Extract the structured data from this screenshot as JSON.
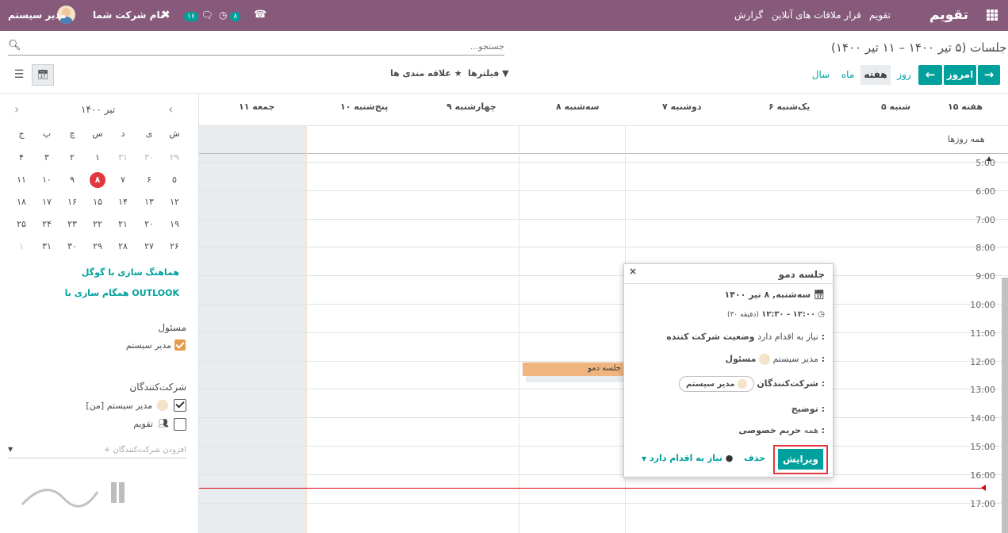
{
  "topbar": {
    "app_title": "تقویم",
    "menu": [
      "تقویم",
      "قرار ملاقات های آنلاین",
      "گزارش"
    ],
    "company": "نام شرکت شما",
    "user": "مدیر سیستم",
    "activity_count": "۸",
    "messages_count": "۱۶"
  },
  "breadcrumb": "جلسات (۵ تیر ۱۴۰۰ – ۱۱ تیر ۱۴۰۰)",
  "search": {
    "placeholder": "جستجو..."
  },
  "controls": {
    "today": "امروز",
    "day": "روز",
    "week": "هفته",
    "month": "ماه",
    "year": "سال",
    "filters": "فیلترها",
    "favorites": "علاقه مندی ها"
  },
  "week_header": {
    "week_label": "هفته ۱۵",
    "days": [
      "شنبه ۵",
      "یک‌شنبه ۶",
      "دوشنبه ۷",
      "سه‌شنبه ۸",
      "چهارشنبه ۹",
      "پنج‌شنبه ۱۰",
      "جمعه ۱۱"
    ],
    "all_day": "همه روزها"
  },
  "hours": [
    "5:00",
    "6:00",
    "7:00",
    "8:00",
    "9:00",
    "10:00",
    "11:00",
    "12:00",
    "13:00",
    "14:00",
    "15:00",
    "16:00",
    "17:00"
  ],
  "event": {
    "title": "جلسه دمو"
  },
  "mini_calendar": {
    "month": "تیر ۱۴۰۰",
    "weekdays": [
      "ش",
      "ی",
      "د",
      "س",
      "چ",
      "پ",
      "ج"
    ],
    "weeks": [
      [
        "۲۹",
        "۳۰",
        "۳۱",
        "۱",
        "۲",
        "۳",
        "۴"
      ],
      [
        "۵",
        "۶",
        "۷",
        "۸",
        "۹",
        "۱۰",
        "۱۱"
      ],
      [
        "۱۲",
        "۱۳",
        "۱۴",
        "۱۵",
        "۱۶",
        "۱۷",
        "۱۸"
      ],
      [
        "۱۹",
        "۲۰",
        "۲۱",
        "۲۲",
        "۲۳",
        "۲۴",
        "۲۵"
      ],
      [
        "۲۶",
        "۲۷",
        "۲۸",
        "۲۹",
        "۳۰",
        "۳۱",
        "۱"
      ]
    ],
    "today": "۸"
  },
  "sidebar": {
    "google_sync": "هماهنگ سازی با گوگل",
    "outlook_sync": "همگام سازی با OUTLOOK",
    "responsible_title": "مسئول",
    "responsible_item": "مدیر سیستم",
    "attendees_title": "شرکت‌کنندگان",
    "attendee_me": "مدیر سیستم [من]",
    "attendee_calendar": "تقویم",
    "add_attendee": "+ افزودن شرکت‌کنندگان"
  },
  "popup": {
    "title": "جلسه دمو",
    "date": "سه‌شنبه, ۸ تیر ۱۴۰۰",
    "time": "۱۲:۰۰ - ۱۲:۳۰",
    "duration": "(۳۰ دقیقه)",
    "status_label": "وضعیت شرکت کننده :",
    "status_value": "نیاز به اقدام دارد",
    "responsible_label": "مسئول :",
    "responsible_value": "مدیر سیستم",
    "attendees_label": "شرکت‌کنندگان :",
    "attendee_chip": "مدیر سیستم",
    "description_label": "توضیح :",
    "privacy_label": "حریم خصوصی :",
    "privacy_value": "همه",
    "edit": "ویرایش",
    "delete": "حذف",
    "action_needed": "نیاز به اقدام دارد"
  },
  "colors": {
    "brand": "#875a7b",
    "accent": "#00a09d",
    "event": "#f0b47e",
    "today": "#e0383e",
    "now_line": "#d9000d"
  }
}
